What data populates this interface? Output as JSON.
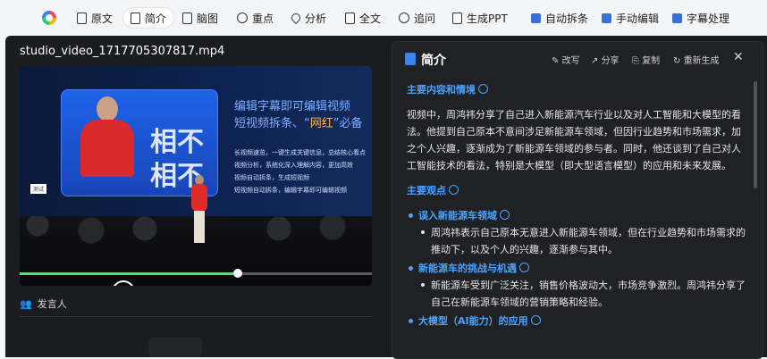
{
  "toolbar": {
    "tabs": [
      {
        "label": "原文"
      },
      {
        "label": "简介"
      },
      {
        "label": "脑图"
      },
      {
        "label": "重点"
      },
      {
        "label": "分析"
      },
      {
        "label": "全文"
      },
      {
        "label": "追问"
      },
      {
        "label": "生成PPT"
      },
      {
        "label": "自动拆条"
      },
      {
        "label": "手动编辑"
      },
      {
        "label": "字幕处理"
      }
    ],
    "active": "简介"
  },
  "video": {
    "filename": "studio_video_1717705307817.mp4",
    "slide_title_line1": "编辑字幕即可编辑视频",
    "slide_title_line2a": "短视频拆条、“",
    "slide_title_hl": "网红",
    "slide_title_line2b": "”必备",
    "slide_points": [
      "长视频速览，一键生成关键信息，总结核心看点",
      "视频分析，系统化深入理解内容，更加高效",
      "视频自动拆条，生成短视频",
      "短视频自动拆条，编辑字幕即可编辑视频"
    ],
    "big_char1": "相不",
    "big_char2": "相不",
    "label_tag": "测试",
    "progress": 0.62,
    "speaker_label": "发言人"
  },
  "panel": {
    "title": "简介",
    "actions": {
      "rewrite": "改写",
      "share": "分享",
      "copy": "复制",
      "regen": "重新生成"
    },
    "sections": {
      "main_heading": "主要内容和情境",
      "main_text": "视频中，周鸿祎分享了自己进入新能源汽车行业以及对人工智能和大模型的看法。他提到自己原本不意间涉足新能源车领域，但因行业趋势和市场需求，加之个人兴趣，逐渐成为了新能源车领域的参与者。同时，他还谈到了自己对人工智能技术的看法，特别是大模型（即大型语言模型）的应用和未来发展。",
      "points_heading": "主要观点",
      "points": [
        {
          "title": "误入新能源车领域",
          "detail": "周鸿祎表示自己原本无意进入新能源车领域，但在行业趋势和市场需求的推动下，以及个人的兴趣，逐渐参与其中。"
        },
        {
          "title": "新能源车的挑战与机遇",
          "detail": "新能源车受到广泛关注，销售价格波动大，市场竞争激烈。周鸿祎分享了自己在新能源车领域的营销策略和经验。"
        },
        {
          "title": "大模型（AI能力）的应用",
          "detail": ""
        }
      ]
    }
  }
}
